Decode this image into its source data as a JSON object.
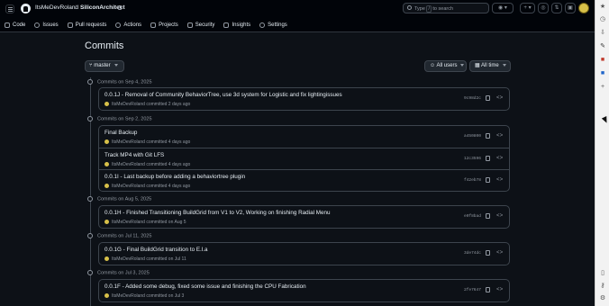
{
  "header": {
    "owner": "ItsMeDevRoland",
    "separator": "/",
    "repo": "SiliconArchitect",
    "search_prefix": "Type",
    "search_key": "/",
    "search_suffix": "to search",
    "plus_label": "+ ▾"
  },
  "tabs": [
    {
      "label": "Code",
      "icon": "code-icon"
    },
    {
      "label": "Issues",
      "icon": "issue-icon"
    },
    {
      "label": "Pull requests",
      "icon": "pull-request-icon"
    },
    {
      "label": "Actions",
      "icon": "actions-icon"
    },
    {
      "label": "Projects",
      "icon": "projects-icon"
    },
    {
      "label": "Security",
      "icon": "shield-icon"
    },
    {
      "label": "Insights",
      "icon": "graph-icon"
    },
    {
      "label": "Settings",
      "icon": "gear-icon"
    }
  ],
  "page": {
    "title": "Commits",
    "branch": "master",
    "users_filter": "All users",
    "time_filter": "All time"
  },
  "groups": [
    {
      "heading": "Commits on Sep 4, 2025",
      "commits": [
        {
          "title": "0.0.1J - Removal of Community BehaviorTree, use 3d system for Logistic and fix lightingissues",
          "author": "ItsMeDevRoland",
          "when": "committed 2 days ago",
          "sha": "9c98d2c"
        }
      ]
    },
    {
      "heading": "Commits on Sep 2, 2025",
      "commits": [
        {
          "title": "Final Backup",
          "author": "ItsMeDevRoland",
          "when": "committed 4 days ago",
          "sha": "a450800"
        },
        {
          "title": "Track MP4 with Git LFS",
          "author": "ItsMeDevRoland",
          "when": "committed 4 days ago",
          "sha": "12c3596"
        },
        {
          "title": "0.0.1I - Last backup before adding a behaviortree plugin",
          "author": "ItsMeDevRoland",
          "when": "committed 4 days ago",
          "sha": "f42eb78"
        }
      ]
    },
    {
      "heading": "Commits on Aug 5, 2025",
      "commits": [
        {
          "title": "0.0.1H - Finished Transitioning BuildGrid from V1 to V2, Working on finishing Radial Menu",
          "author": "ItsMeDevRoland",
          "when": "committed on Aug 5",
          "sha": "e0f8bad"
        }
      ]
    },
    {
      "heading": "Commits on Jul 11, 2025",
      "commits": [
        {
          "title": "0.0.1G - Final BuildGrid transition to E.l.a",
          "author": "ItsMeDevRoland",
          "when": "committed on Jul 11",
          "sha": "3de74dc"
        }
      ]
    },
    {
      "heading": "Commits on Jul 3, 2025",
      "commits": [
        {
          "title": "0.0.1F - Added some debug, fixed some issue and finishing the CPU Fabrication",
          "author": "ItsMeDevRoland",
          "when": "committed on Jul 3",
          "sha": "2fe7647"
        }
      ]
    }
  ],
  "colors": {
    "background": "#0d1117",
    "border": "#3d444d",
    "muted": "#9198a1",
    "text": "#e6edf3"
  }
}
